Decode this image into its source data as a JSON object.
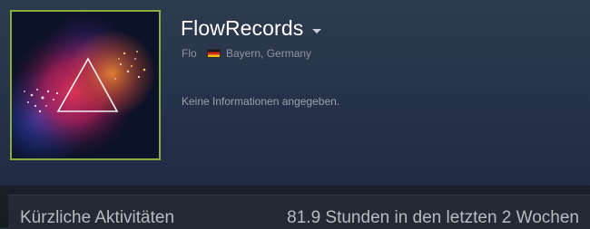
{
  "profile": {
    "persona_name": "FlowRecords",
    "real_name": "Flo",
    "location": "Bayern, Germany",
    "country_flag_icon": "germany-flag-icon",
    "summary": "Keine Informationen angegeben.",
    "avatar_frame_color": "#8cab3f"
  },
  "recent_activity": {
    "title": "Kürzliche Aktivitäten",
    "hours_text": "81.9 Stunden in den letzten 2 Wochen"
  }
}
